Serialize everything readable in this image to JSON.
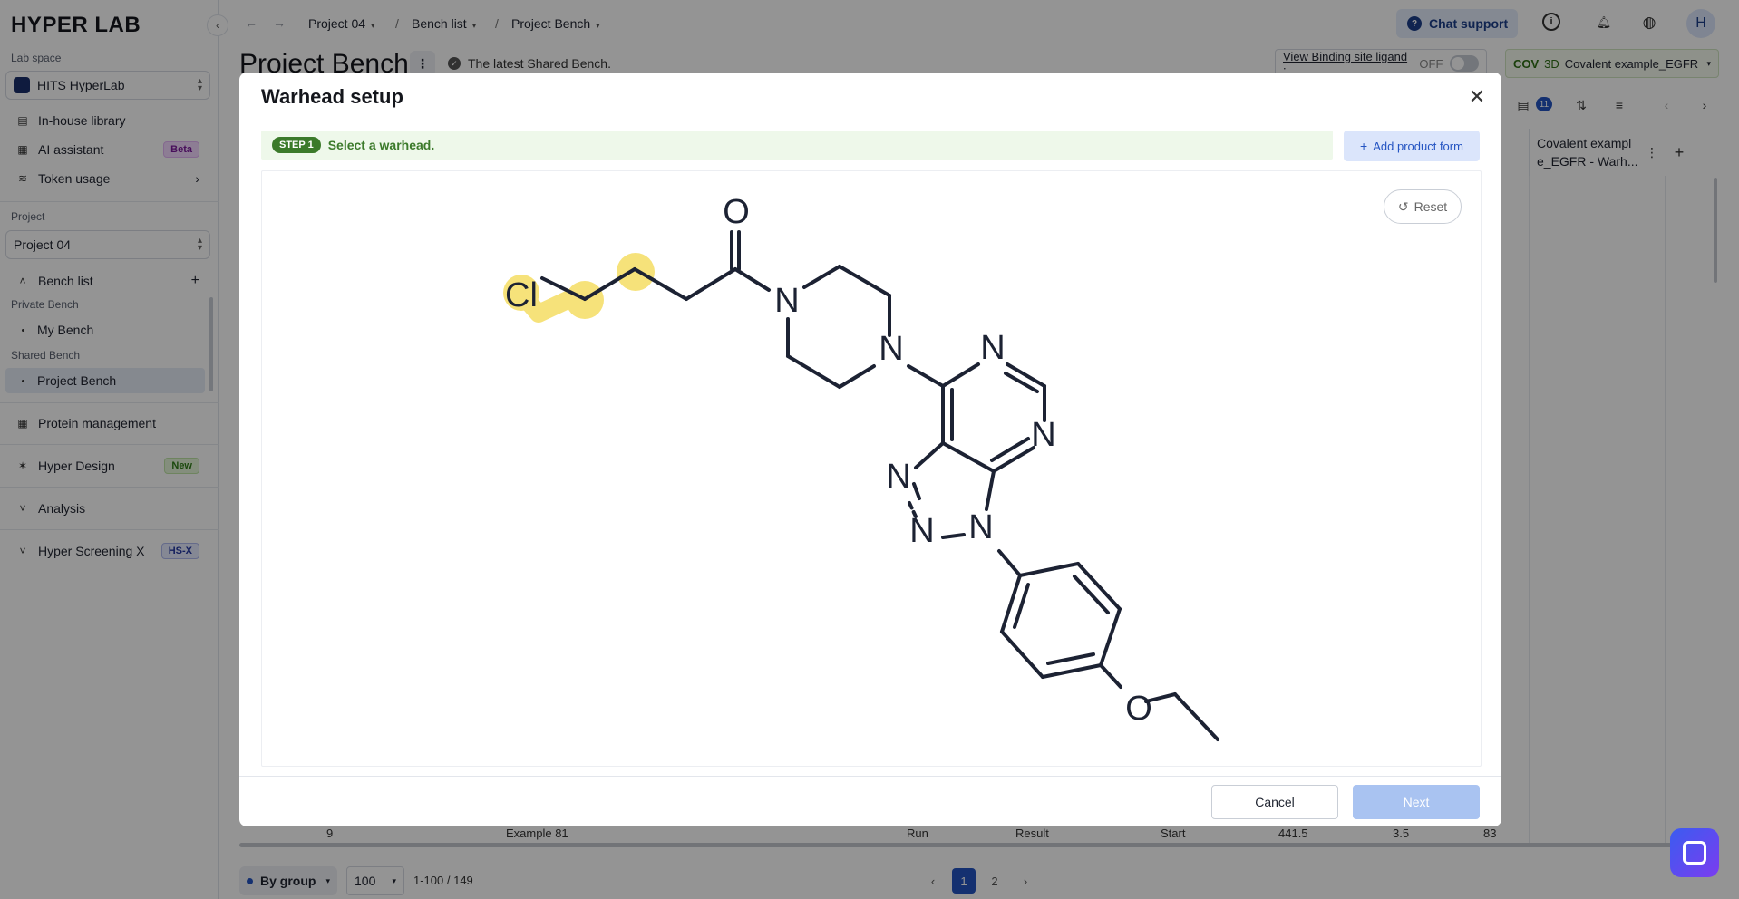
{
  "app": {
    "logo": "HYPER LAB"
  },
  "sidebar": {
    "lab_space_label": "Lab space",
    "workspace": "HITS HyperLab",
    "items": [
      {
        "label": "In-house library"
      },
      {
        "label": "AI assistant",
        "badge": "Beta"
      },
      {
        "label": "Token usage"
      }
    ],
    "project_label": "Project",
    "project": "Project 04",
    "bench_list": "Bench list",
    "private_bench_label": "Private Bench",
    "private_items": [
      "My Bench"
    ],
    "shared_bench_label": "Shared Bench",
    "shared_items": [
      "Project Bench"
    ],
    "protein_management": "Protein management",
    "hyper_design": "Hyper Design",
    "hyper_design_badge": "New",
    "analysis": "Analysis",
    "hyper_screening": "Hyper Screening X",
    "hyper_screening_badge": "HS-X"
  },
  "topbar": {
    "breadcrumbs": [
      "Project 04",
      "Bench list",
      "Project Bench"
    ],
    "chat_support": "Chat support",
    "avatar": "H"
  },
  "page": {
    "title": "Project Bench",
    "latest_text": "The latest Shared Bench.",
    "binding_label": "View Binding site ligand :",
    "binding_state": "OFF",
    "cov_tag": "COV",
    "cov_3d": "3D",
    "cov_name": "Covalent example_EGFR",
    "column_count": "11",
    "column_header": "Covalent exampl e_EGFR - Warh...",
    "row_peek": {
      "index": "9",
      "name": "Example 81",
      "run": "Run",
      "result": "Result",
      "start": "Start",
      "v1": "441.5",
      "v2": "3.5",
      "v3": "83"
    }
  },
  "footer": {
    "group": "By group",
    "page_size": "100",
    "range": "1-100 / 149",
    "pages": [
      "1",
      "2"
    ],
    "current_page": "1"
  },
  "modal": {
    "title": "Warhead setup",
    "step_badge": "STEP 1",
    "step_text": "Select a warhead.",
    "add_product_form": "Add product form",
    "reset": "Reset",
    "cancel": "Cancel",
    "next": "Next",
    "atom_labels": {
      "cl": "Cl",
      "o_carbonyl": "O",
      "n_pip1": "N",
      "n_pip2": "N",
      "n_pyr1": "N",
      "n_pyr2": "N",
      "n_tri1": "N",
      "n_tri2": "N",
      "n_tri3": "N",
      "o_ether": "O"
    },
    "highlight_color": "#f6e27a"
  }
}
